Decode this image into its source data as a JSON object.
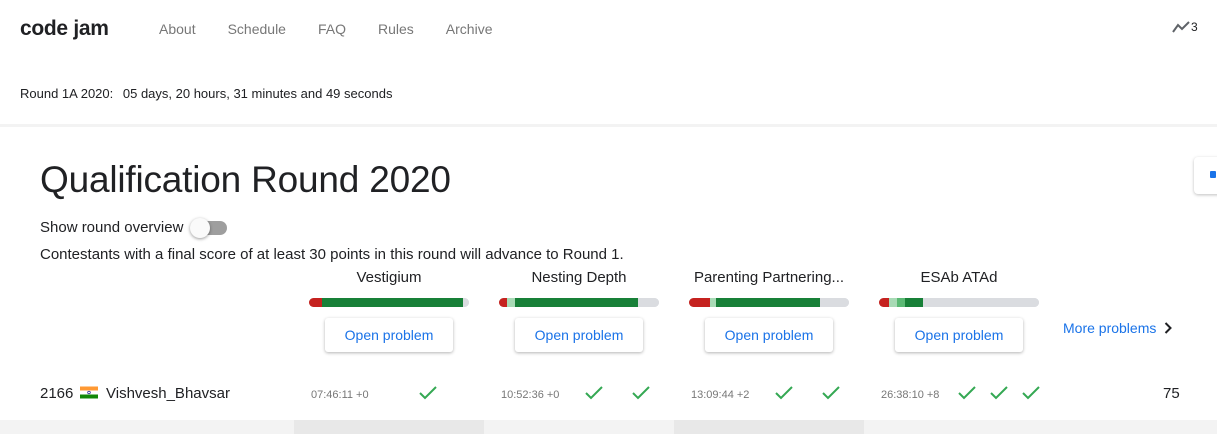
{
  "header": {
    "logo": "code jam",
    "nav": [
      "About",
      "Schedule",
      "FAQ",
      "Rules",
      "Archive"
    ],
    "trend_count": "3",
    "trend_icon": "trending-icon"
  },
  "countdown": {
    "label": "Round 1A 2020:",
    "time": "05 days, 20 hours, 31 minutes and 49 seconds"
  },
  "round": {
    "title": "Qualification Round 2020",
    "overview_label": "Show round overview",
    "overview_on": false,
    "advance_text": "Contestants with a final score of at least 30 points in this round will advance to Round 1."
  },
  "problems": [
    {
      "name": "Vestigium",
      "button": "Open problem",
      "bar": [
        {
          "color": "#c5221f",
          "frac": 0.08
        },
        {
          "color": "#188038",
          "frac": 0.88
        },
        {
          "color": "#dadce0",
          "frac": 0.04
        }
      ]
    },
    {
      "name": "Nesting Depth",
      "button": "Open problem",
      "bar": [
        {
          "color": "#c5221f",
          "frac": 0.05
        },
        {
          "color": "#a8dab5",
          "frac": 0.05
        },
        {
          "color": "#188038",
          "frac": 0.77
        },
        {
          "color": "#dadce0",
          "frac": 0.13
        }
      ]
    },
    {
      "name": "Parenting Partnering...",
      "button": "Open problem",
      "bar": [
        {
          "color": "#c5221f",
          "frac": 0.13
        },
        {
          "color": "#a8dab5",
          "frac": 0.04
        },
        {
          "color": "#188038",
          "frac": 0.65
        },
        {
          "color": "#dadce0",
          "frac": 0.18
        }
      ]
    },
    {
      "name": "ESAb ATAd",
      "button": "Open problem",
      "bar": [
        {
          "color": "#c5221f",
          "frac": 0.06
        },
        {
          "color": "#a8dab5",
          "frac": 0.05
        },
        {
          "color": "#5bb974",
          "frac": 0.05
        },
        {
          "color": "#188038",
          "frac": 0.11
        },
        {
          "color": "#dadce0",
          "frac": 0.73
        }
      ]
    }
  ],
  "more_problems": "More problems",
  "contestant": {
    "rank": "2166",
    "country_flag": "india-flag-icon",
    "name": "Vishvesh_Bhavsar",
    "results": [
      {
        "time": "07:46:11 +0",
        "checks": 1
      },
      {
        "time": "10:52:36 +0",
        "checks": 2
      },
      {
        "time": "13:09:44 +2",
        "checks": 2
      },
      {
        "time": "26:38:10 +8",
        "checks": 3
      }
    ],
    "score": "75"
  },
  "colors": {
    "accent": "#1a73e8",
    "correct": "#34a853"
  }
}
